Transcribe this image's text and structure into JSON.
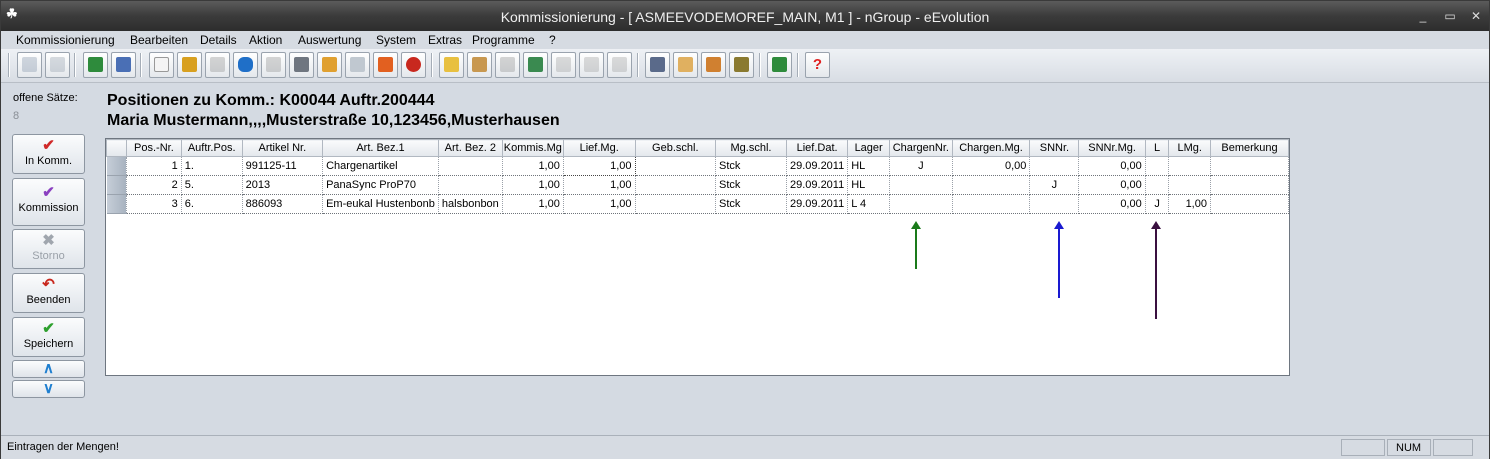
{
  "window": {
    "title": "Kommissionierung - [ ASMEEVODEMOREF_MAIN, M1 ]  -  nGroup - eEvolution",
    "controls": [
      "_",
      "▭",
      "✕"
    ]
  },
  "menu": [
    "Kommissionierung",
    "Bearbeiten",
    "Details",
    "Aktion",
    "Auswertung",
    "System",
    "Extras",
    "Programme",
    "?"
  ],
  "toolbar_icons": [
    "search-icon",
    "edit-icon",
    "excel-export-icon",
    "print-icon",
    "new-document-icon",
    "spellcheck-icon",
    "eraser-icon",
    "database-icon",
    "delete-icon",
    "keyboard-icon",
    "goods-icon",
    "label-icon",
    "alarm-icon",
    "undo-icon",
    "notepad-icon",
    "package-icon",
    "stack-icon",
    "truck-icon",
    "disabled-icon",
    "transfer-icon",
    "hand-icon",
    "calendar-icon",
    "document-icon",
    "users-icon",
    "car-icon",
    "exit-icon",
    "help-icon"
  ],
  "side": {
    "offene_label": "offene Sätze:",
    "offene_count": "8",
    "buttons": {
      "in_komm": "In Komm.",
      "kommission": "Kommission",
      "storno": "Storno",
      "beenden": "Beenden",
      "speichern": "Speichern"
    }
  },
  "header": {
    "title": "Positionen zu Komm.: K00044 Auftr.200444",
    "customer": "Maria Mustermann,,,,Musterstraße 10,123456,Musterhausen"
  },
  "grid": {
    "columns": [
      "Pos.-Nr.",
      "Auftr.Pos.",
      "Artikel Nr.",
      "Art. Bez.1",
      "Art. Bez. 2",
      "Kommis.Mg",
      "Lief.Mg.",
      "Geb.schl.",
      "Mg.schl.",
      "Lief.Dat.",
      "Lager",
      "ChargenNr.",
      "Chargen.Mg.",
      "SNNr.",
      "SNNr.Mg.",
      "L",
      "LMg.",
      "Bemerkung"
    ],
    "rows": [
      [
        "1",
        "1.",
        "991125-11",
        "Chargenartikel",
        "",
        "1,00",
        "1,00",
        "",
        "Stck",
        "29.09.2011",
        "HL",
        "J",
        "0,00",
        "",
        "0,00",
        "",
        "",
        ""
      ],
      [
        "2",
        "5.",
        "2013",
        "PanaSync ProP70",
        "",
        "1,00",
        "1,00",
        "",
        "Stck",
        "29.09.2011",
        "HL",
        "",
        "",
        "J",
        "0,00",
        "",
        "",
        ""
      ],
      [
        "3",
        "6.",
        "886093",
        "Em-eukal Hustenbonb",
        "halsbonbon",
        "1,00",
        "1,00",
        "",
        "Stck",
        "29.09.2011",
        "L 4",
        "",
        "",
        "",
        "0,00",
        "J",
        "1,00",
        ""
      ]
    ]
  },
  "annotation_colors": {
    "chargen_arrow": "#1a7a1a",
    "snnr_arrow": "#1a1ad0",
    "lager_arrow": "#3a1040"
  },
  "status": {
    "text": "Eintragen der Mengen!",
    "num": "NUM"
  }
}
